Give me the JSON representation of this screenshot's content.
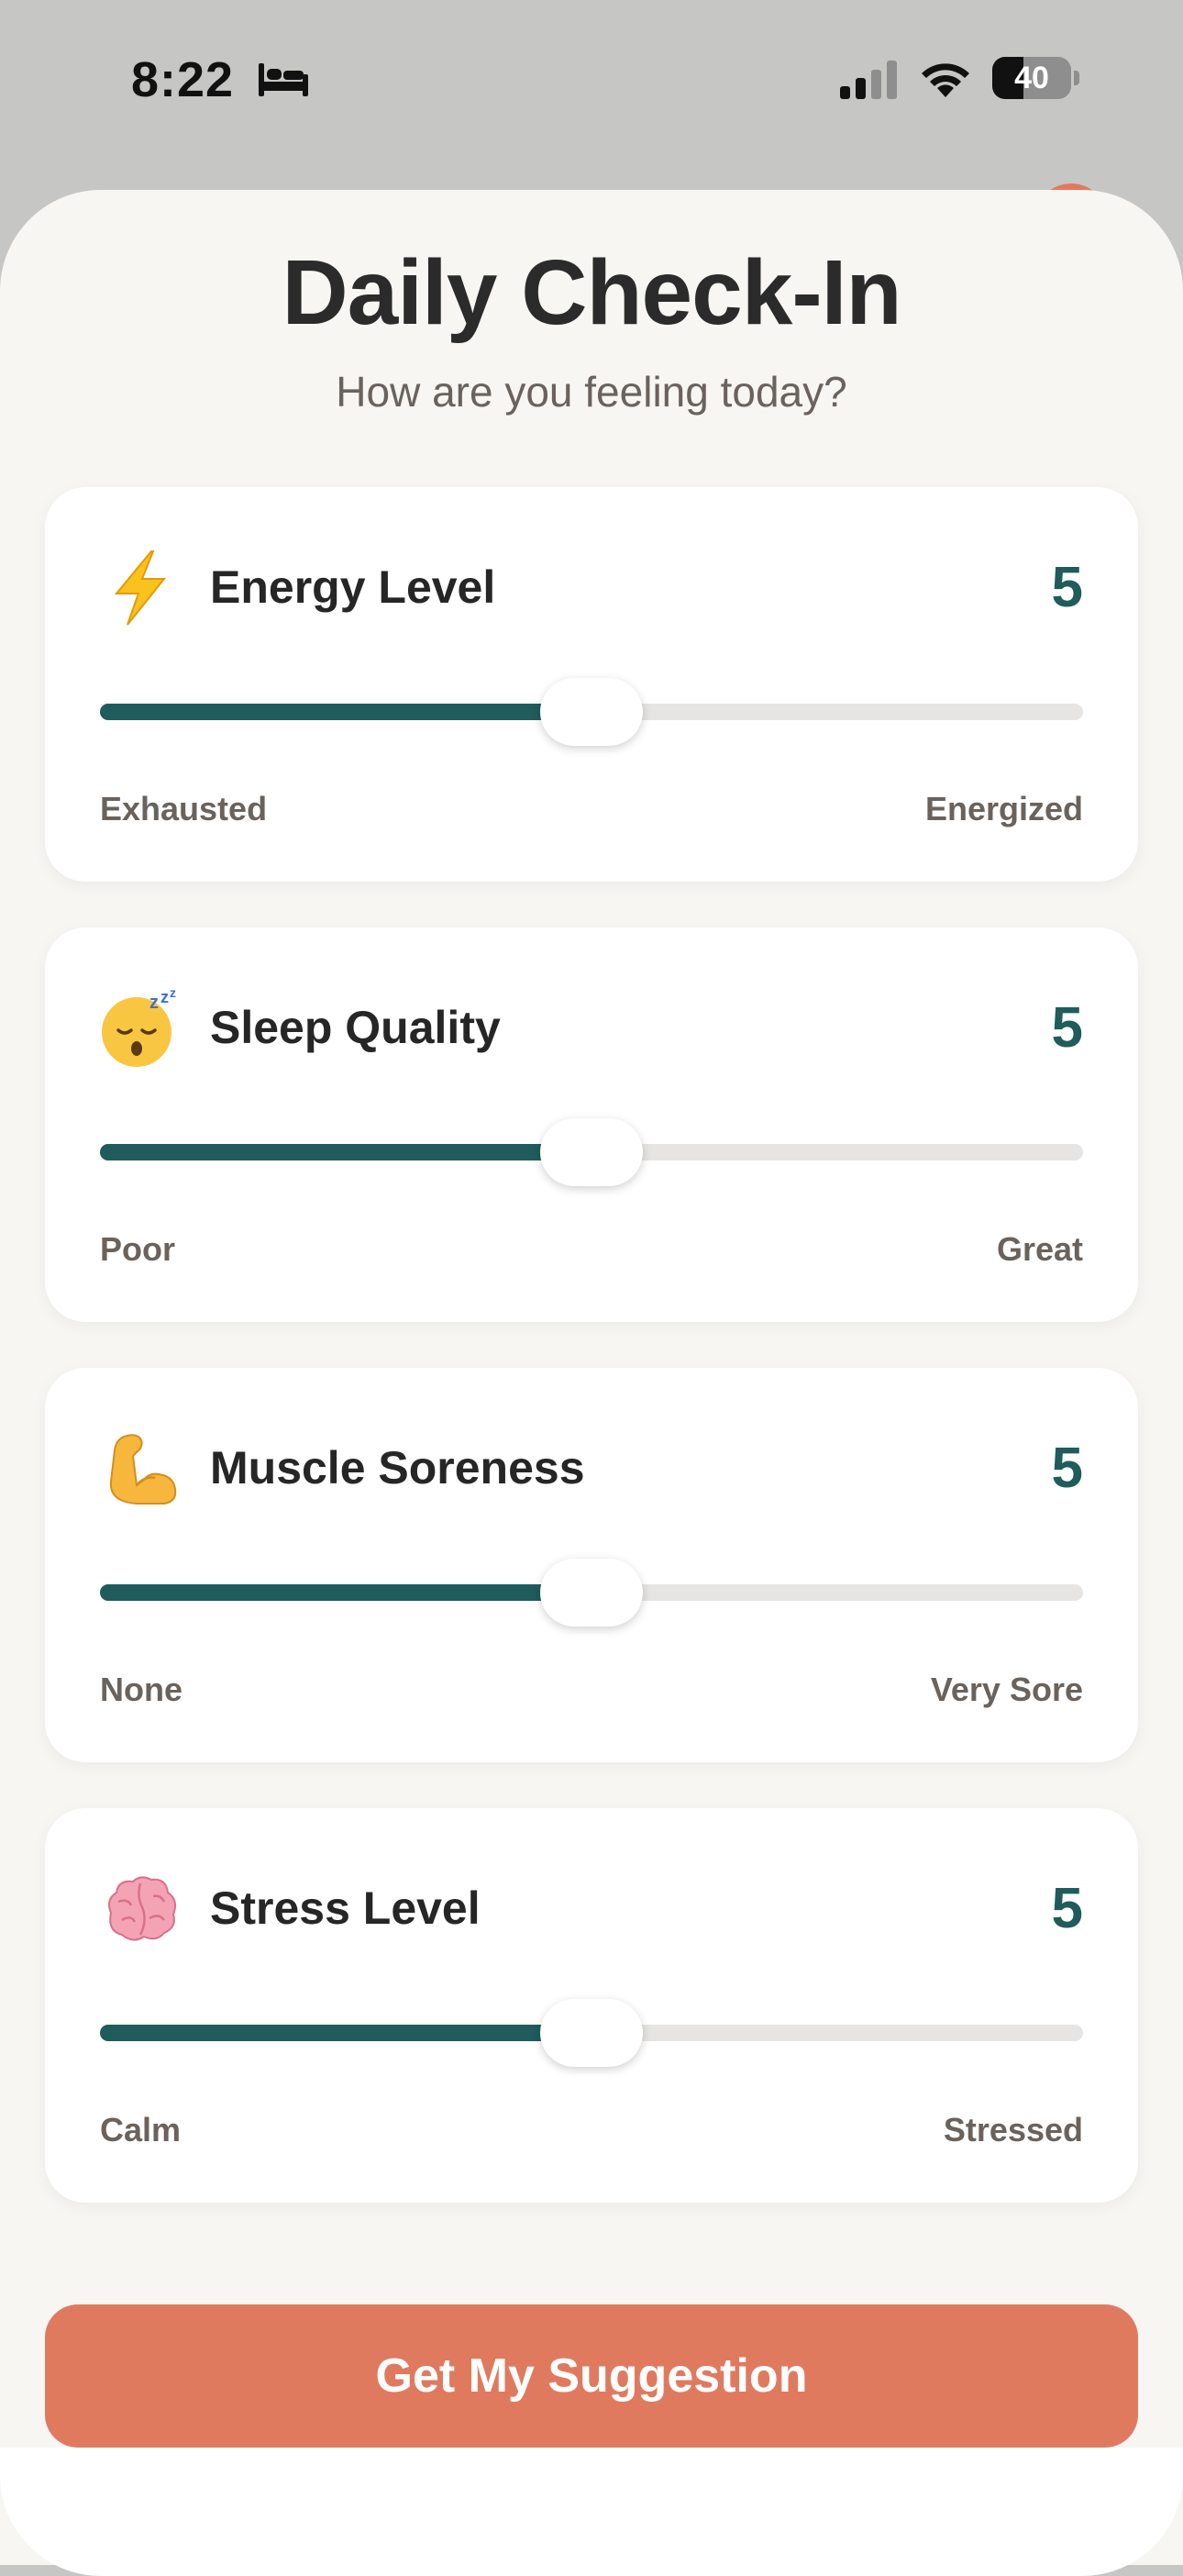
{
  "status_bar": {
    "time": "8:22",
    "battery_level": "40",
    "battery_percent": 40,
    "icons": [
      "bed-icon",
      "cellular-signal-icon",
      "wifi-icon",
      "battery-icon"
    ]
  },
  "header": {
    "title": "Daily Check-In",
    "subtitle": "How are you feeling today?"
  },
  "metrics": [
    {
      "label": "Energy Level",
      "icon": "lightning-bolt-icon",
      "value": "5",
      "value_number": 5,
      "min": 1,
      "max": 10,
      "fill_fraction": 0.5,
      "min_label": "Exhausted",
      "max_label": "Energized"
    },
    {
      "label": "Sleep Quality",
      "icon": "sleeping-face-icon",
      "value": "5",
      "value_number": 5,
      "min": 1,
      "max": 10,
      "fill_fraction": 0.5,
      "min_label": "Poor",
      "max_label": "Great"
    },
    {
      "label": "Muscle Soreness",
      "icon": "flexed-biceps-icon",
      "value": "5",
      "value_number": 5,
      "min": 1,
      "max": 10,
      "fill_fraction": 0.5,
      "min_label": "None",
      "max_label": "Very Sore"
    },
    {
      "label": "Stress Level",
      "icon": "brain-icon",
      "value": "5",
      "value_number": 5,
      "min": 1,
      "max": 10,
      "fill_fraction": 0.5,
      "min_label": "Calm",
      "max_label": "Stressed"
    }
  ],
  "actions": {
    "submit_label": "Get My Suggestion"
  },
  "colors": {
    "accent": "#1f5c5b",
    "button": "#e07a5f",
    "background": "#f7f6f3",
    "card": "#ffffff",
    "track": "#e6e5e3"
  }
}
